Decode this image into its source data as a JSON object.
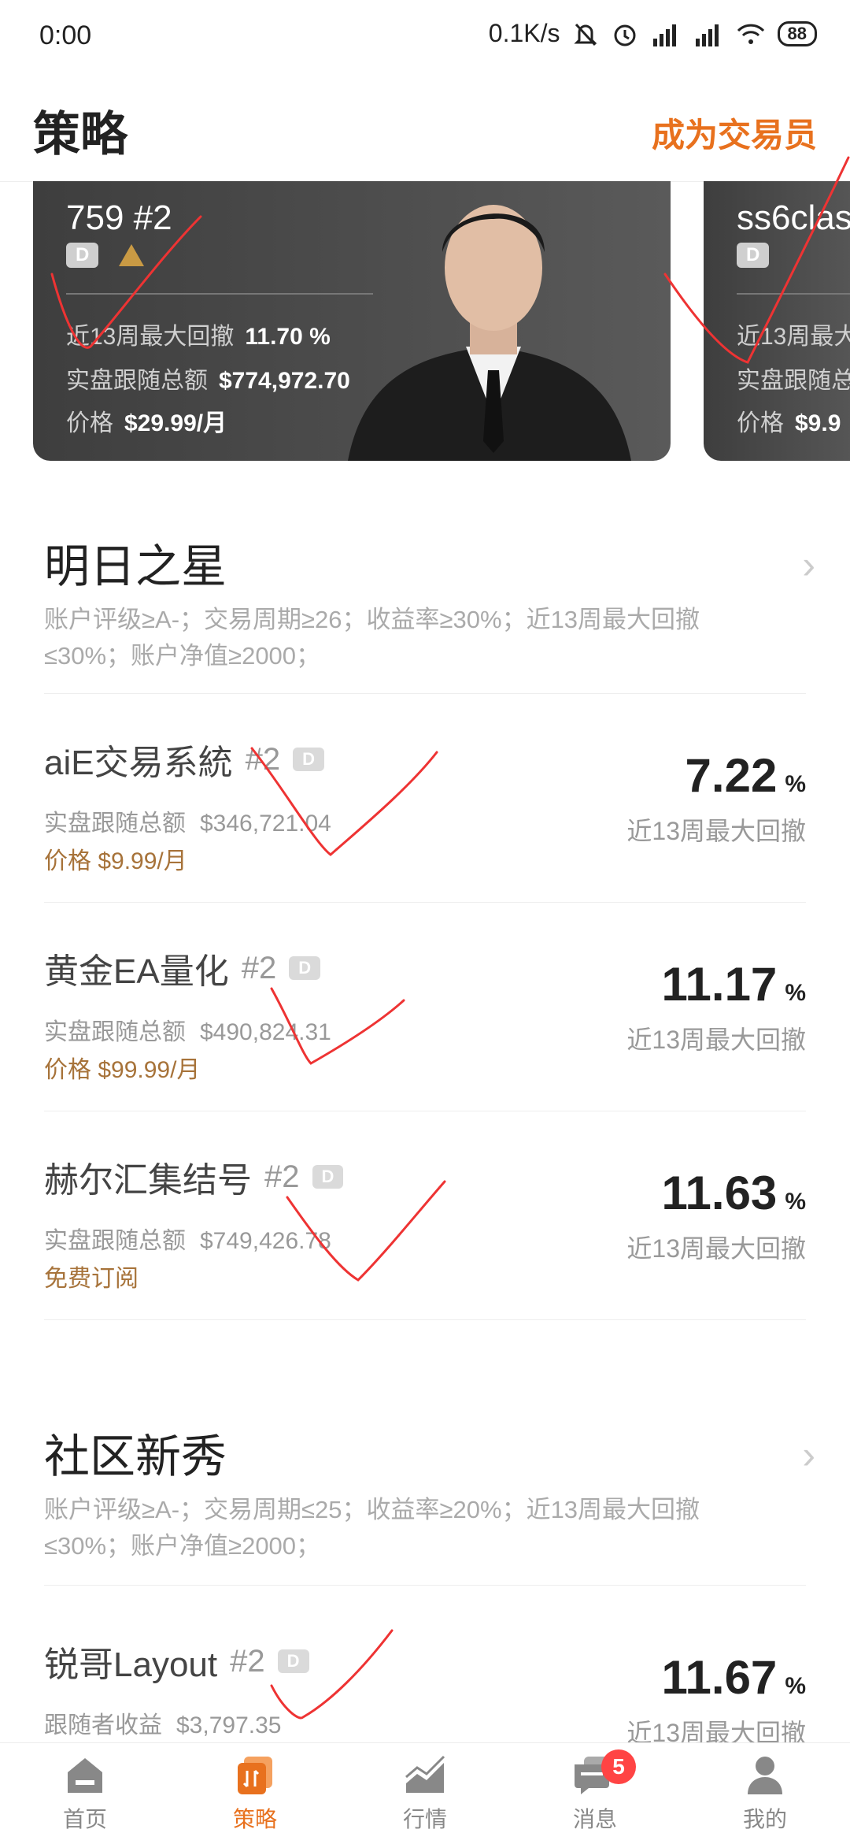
{
  "status_bar": {
    "time": "0:00",
    "network_speed": "0.1K/s",
    "battery": "88"
  },
  "header": {
    "title": "策略",
    "become_trader": "成为交易员"
  },
  "featured": [
    {
      "name": "759 #2",
      "badge": "D",
      "max_drawdown_label": "近13周最大回撤",
      "max_drawdown_value": "11.70 %",
      "follow_label": "实盘跟随总额",
      "follow_value": "$774,972.70",
      "price_label": "价格",
      "price_value": "$29.99/月"
    },
    {
      "name": "ss6clas",
      "badge": "D",
      "max_drawdown_label": "近13周最大",
      "follow_label": "实盘跟随总",
      "price_label": "价格",
      "price_value": "$9.9"
    }
  ],
  "section_star": {
    "title": "明日之星",
    "desc_line1": "账户评级≥A-；交易周期≥26；收益率≥30%；近13周最大回撤",
    "desc_line2": "≤30%；账户净值≥2000；"
  },
  "star_items": [
    {
      "name": "aiE交易系統",
      "num": "#2",
      "badge": "D",
      "follow_label": "实盘跟随总额",
      "follow_value": "$346,721.04",
      "price": "价格 $9.99/月",
      "pct": "7.22",
      "pct_unit": "%",
      "pct_label": "近13周最大回撤"
    },
    {
      "name": "黄金EA量化",
      "num": "#2",
      "badge": "D",
      "follow_label": "实盘跟随总额",
      "follow_value": "$490,824.31",
      "price": "价格 $99.99/月",
      "pct": "11.17",
      "pct_unit": "%",
      "pct_label": "近13周最大回撤"
    },
    {
      "name": "赫尔汇集结号",
      "num": "#2",
      "badge": "D",
      "follow_label": "实盘跟随总额",
      "follow_value": "$749,426.78",
      "price": "免费订阅",
      "pct": "11.63",
      "pct_unit": "%",
      "pct_label": "近13周最大回撤"
    }
  ],
  "section_new": {
    "title": "社区新秀",
    "desc_line1": "账户评级≥A-；交易周期≤25；收益率≥20%；近13周最大回撤",
    "desc_line2": "≤30%；账户净值≥2000；"
  },
  "new_items": [
    {
      "name": "锐哥Layout",
      "num": "#2",
      "badge": "D",
      "follow_label": "跟随者收益",
      "follow_value": "$3,797.35",
      "pct": "11.67",
      "pct_unit": "%",
      "pct_label": "近13周最大回撤"
    }
  ],
  "tabbar": {
    "home": "首页",
    "strategy": "策略",
    "market": "行情",
    "messages": "消息",
    "messages_count": "5",
    "mine": "我的"
  }
}
